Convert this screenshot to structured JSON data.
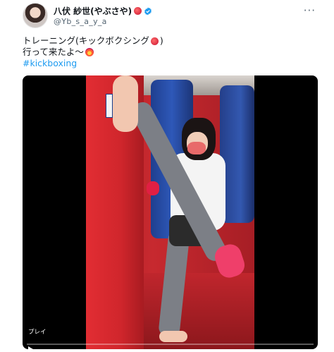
{
  "tweet": {
    "author_name": "八伏 紗世(やぶさや)",
    "handle": "@Yb_s_a_y_a",
    "verified": true,
    "more_label": "···",
    "text_line1": "トレーニング(キックボクシング",
    "text_line1_end": ")",
    "text_line2": "行って来たよ〜",
    "hashtag": "#kickboxing",
    "icons": {
      "name_emoji": "boxing-glove-emoji",
      "verified": "verified-badge-icon",
      "text_emoji1": "boxing-glove-emoji",
      "text_emoji2": "fire-heart-emoji",
      "more": "more-options-icon"
    }
  },
  "media": {
    "play_label": "プレイ",
    "progress_value": 0,
    "colors": {
      "accent": "#1d9bf0",
      "verified": "#1d9bf0"
    }
  }
}
